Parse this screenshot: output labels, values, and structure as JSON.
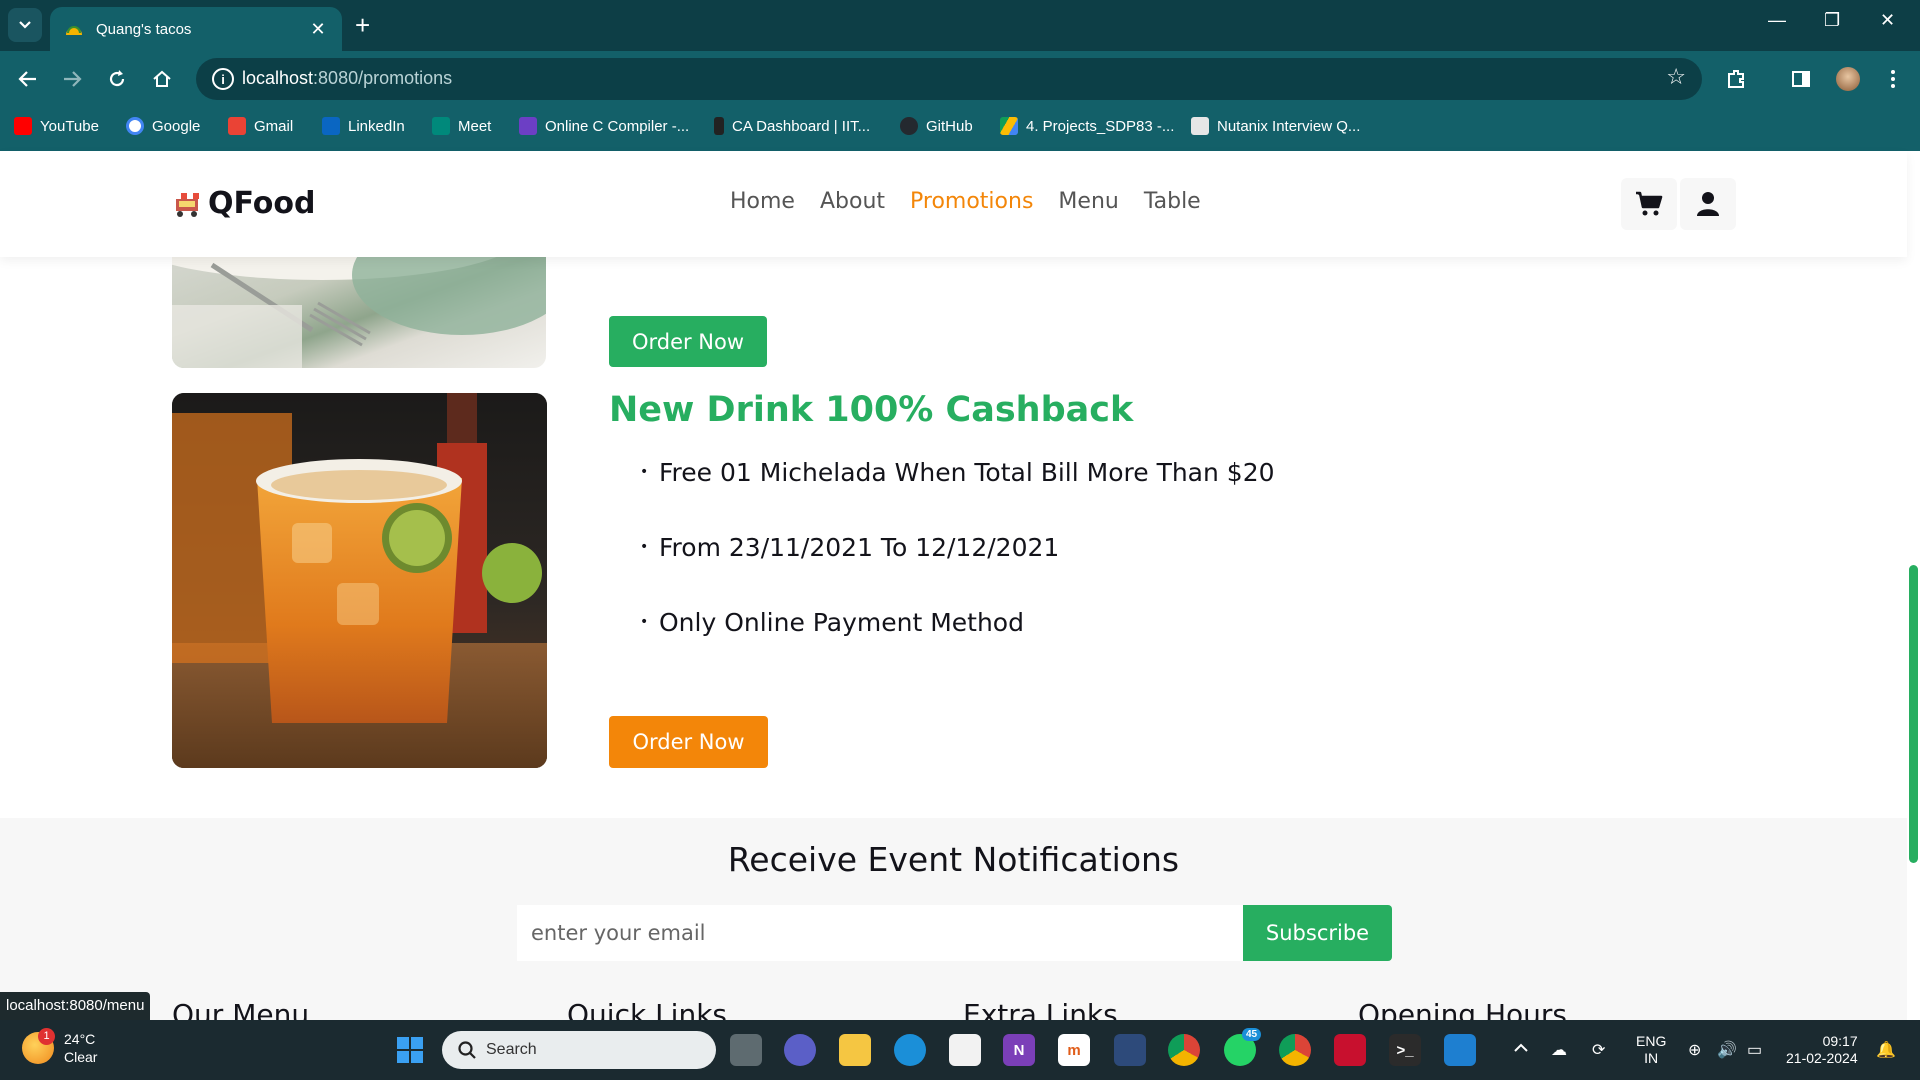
{
  "browser": {
    "tab_title": "Quang's tacos",
    "url_host": "localhost",
    "url_rest": ":8080/promotions",
    "bookmarks": [
      {
        "label": "YouTube",
        "color": "#ff0000"
      },
      {
        "label": "Google",
        "color": "#4285f4"
      },
      {
        "label": "Gmail",
        "color": "#ea4335"
      },
      {
        "label": "LinkedIn",
        "color": "#0a66c2"
      },
      {
        "label": "Meet",
        "color": "#00897b"
      },
      {
        "label": "Online C Compiler -...",
        "color": "#6c3fc5"
      },
      {
        "label": "CA Dashboard | IIT...",
        "color": "#222222"
      },
      {
        "label": "GitHub",
        "color": "#24292f"
      },
      {
        "label": "4. Projects_SDP83 -...",
        "color": "#fbbc04"
      },
      {
        "label": "Nutanix Interview Q...",
        "color": "#dddddd"
      }
    ],
    "status_url": "localhost:8080/menu"
  },
  "site": {
    "brand": "QFood",
    "nav": [
      {
        "label": "Home",
        "active": false
      },
      {
        "label": "About",
        "active": false
      },
      {
        "label": "Promotions",
        "active": true
      },
      {
        "label": "Menu",
        "active": false
      },
      {
        "label": "Table",
        "active": false
      }
    ],
    "icons": [
      "cart-icon",
      "user-icon"
    ]
  },
  "promotions": {
    "first_order_label": "Order Now",
    "promo": {
      "title": "New Drink 100% Cashback",
      "points": [
        "Free 01 Michelada When Total Bill More Than $20",
        "From 23/11/2021 To 12/12/2021",
        "Only Online Payment Method"
      ],
      "order_label": "Order Now"
    }
  },
  "newsletter": {
    "title": "Receive Event Notifications",
    "placeholder": "enter your email",
    "button": "Subscribe"
  },
  "footer_headings": [
    "Our Menu",
    "Quick Links",
    "Extra Links",
    "Opening Hours"
  ],
  "taskbar": {
    "weather_temp": "24°C",
    "weather_cond": "Clear",
    "weather_badge": "1",
    "search_label": "Search",
    "whatsapp_badge": "45",
    "lang_line1": "ENG",
    "lang_line2": "IN",
    "time": "09:17",
    "date": "21-02-2024"
  },
  "colors": {
    "brand_green": "#27ae60",
    "brand_orange": "#f38609",
    "chrome_teal": "#136069"
  }
}
